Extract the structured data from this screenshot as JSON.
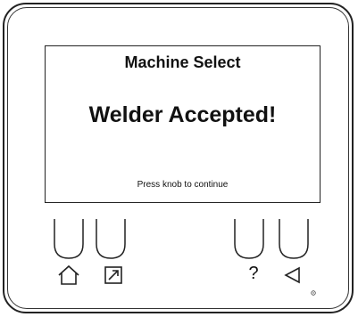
{
  "screen": {
    "title": "Machine Select",
    "message": "Welder Accepted!",
    "hint": "Press knob to continue"
  },
  "softkeys": [
    {
      "icon": "home-icon"
    },
    {
      "icon": "square-arrow-icon"
    },
    {
      "label": "?",
      "icon": "help-icon"
    },
    {
      "icon": "back-triangle-icon"
    }
  ]
}
